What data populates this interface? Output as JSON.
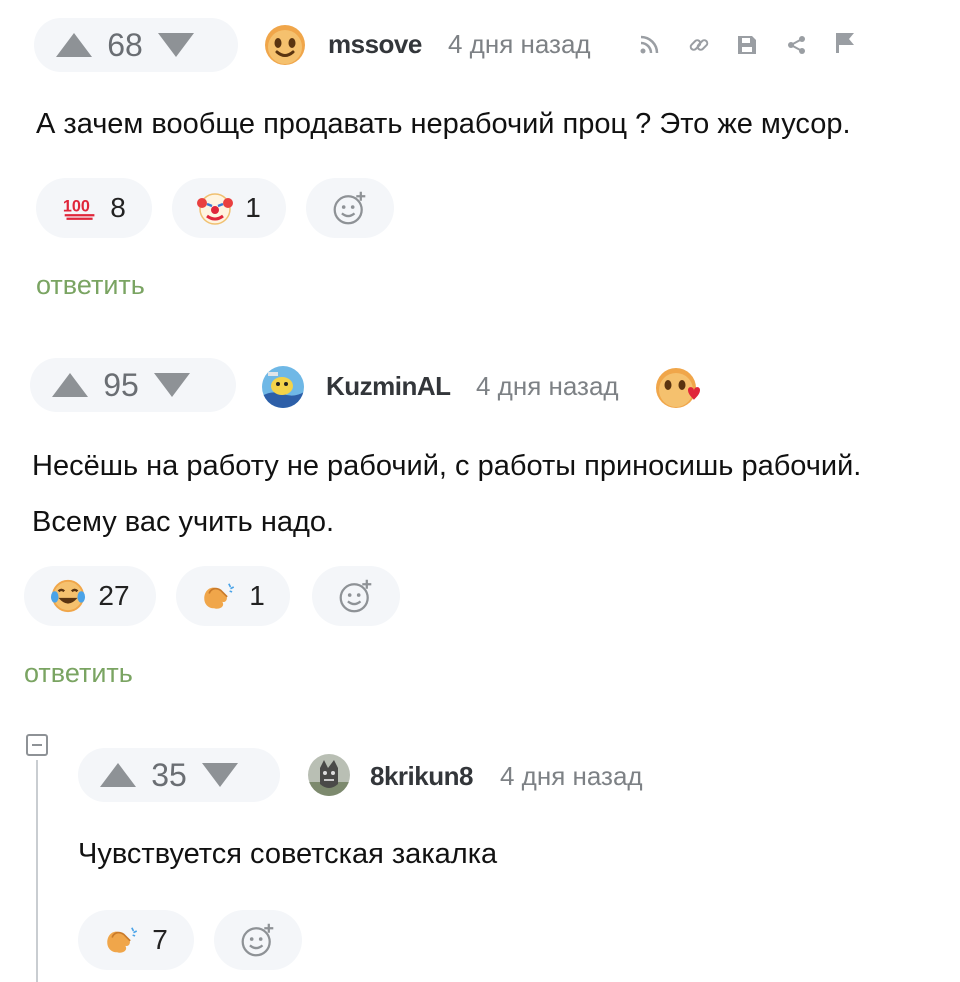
{
  "comments": [
    {
      "votes": "68",
      "username": "mssove",
      "time": "4 дня назад",
      "text_lines": [
        "А зачем вообще продавать нерабочий проц ? Это же мусор."
      ],
      "reactions": [
        {
          "icon": "hundred-points-icon",
          "count": "8"
        },
        {
          "icon": "clown-face-icon",
          "count": "1"
        }
      ],
      "reply_label": "ответить"
    },
    {
      "votes": "95",
      "username": "KuzminAL",
      "time": "4 дня назад",
      "text_lines": [
        "Несёшь на работу не рабочий, с работы приносишь рабочий.",
        "Всему вас учить надо."
      ],
      "reactions": [
        {
          "icon": "tears-of-joy-icon",
          "count": "27"
        },
        {
          "icon": "clapping-hands-icon",
          "count": "1"
        }
      ],
      "reply_label": "ответить"
    },
    {
      "votes": "35",
      "username": "8krikun8",
      "time": "4 дня назад",
      "text_lines": [
        "Чувствуется советская закалка"
      ],
      "reactions": [
        {
          "icon": "clapping-hands-icon",
          "count": "7"
        }
      ]
    }
  ],
  "colors": {
    "pill_bg": "#f4f6f9",
    "reply_link": "#7aa462",
    "arrow": "#8e9296"
  }
}
